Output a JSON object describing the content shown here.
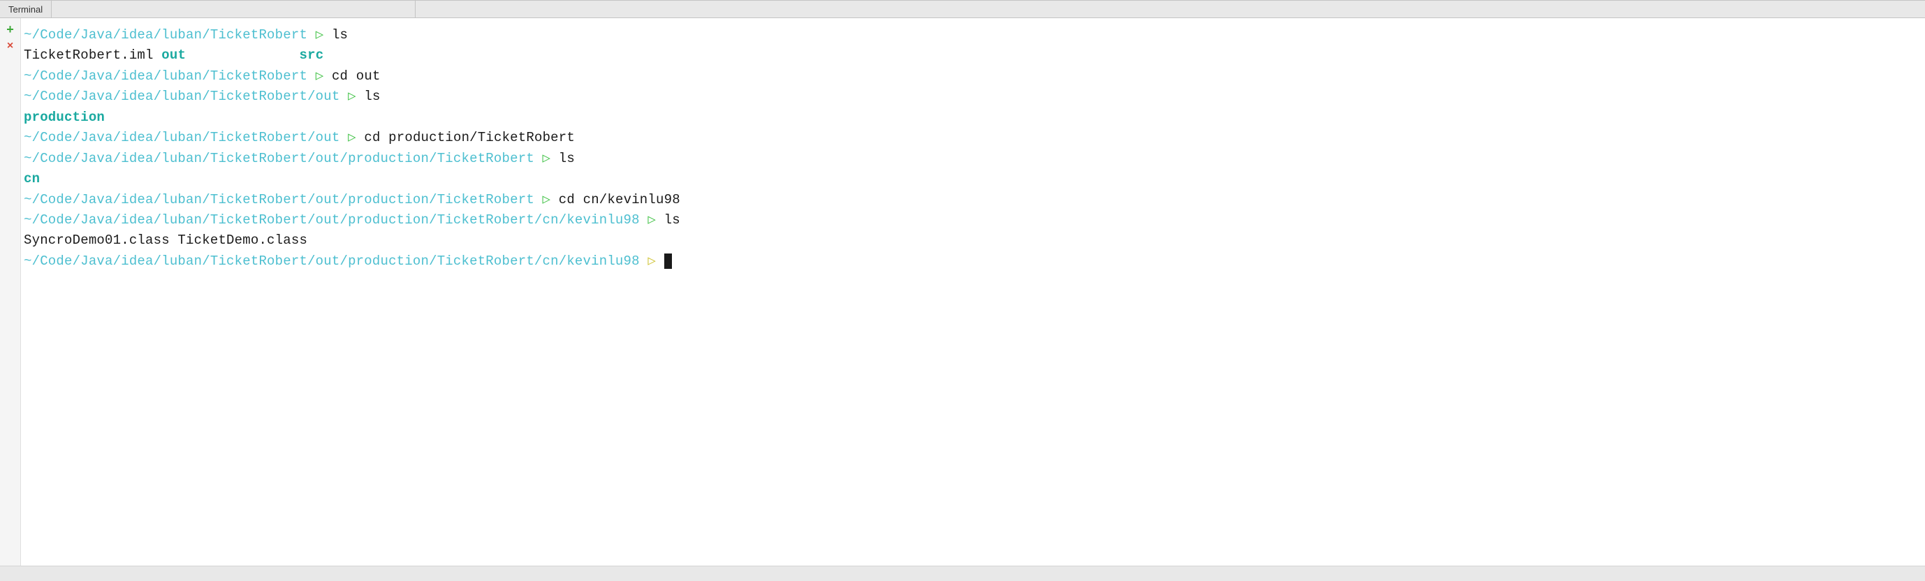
{
  "tab": {
    "label": "Terminal"
  },
  "gutter": {
    "add": "+",
    "close": "×"
  },
  "arrow": "▷",
  "lines": [
    {
      "type": "prompt",
      "path": "~/Code/Java/idea/luban/TicketRobert",
      "arrowClass": "arrow",
      "cmd": "ls"
    },
    {
      "type": "ls1",
      "file": "TicketRobert.iml ",
      "dir1": "out",
      "spacer": "              ",
      "dir2": "src"
    },
    {
      "type": "prompt",
      "path": "~/Code/Java/idea/luban/TicketRobert",
      "arrowClass": "arrow",
      "cmd": "cd out"
    },
    {
      "type": "prompt",
      "path": "~/Code/Java/idea/luban/TicketRobert/out",
      "arrowClass": "arrow",
      "cmd": "ls"
    },
    {
      "type": "dir",
      "text": "production"
    },
    {
      "type": "prompt",
      "path": "~/Code/Java/idea/luban/TicketRobert/out",
      "arrowClass": "arrow",
      "cmd": "cd production/TicketRobert"
    },
    {
      "type": "prompt",
      "path": "~/Code/Java/idea/luban/TicketRobert/out/production/TicketRobert",
      "arrowClass": "arrow",
      "cmd": "ls"
    },
    {
      "type": "dir",
      "text": "cn"
    },
    {
      "type": "prompt",
      "path": "~/Code/Java/idea/luban/TicketRobert/out/production/TicketRobert",
      "arrowClass": "arrow",
      "cmd": "cd cn/kevinlu98"
    },
    {
      "type": "prompt",
      "path": "~/Code/Java/idea/luban/TicketRobert/out/production/TicketRobert/cn/kevinlu98",
      "arrowClass": "arrow",
      "cmd": "ls"
    },
    {
      "type": "plain",
      "text": "SyncroDemo01.class TicketDemo.class"
    },
    {
      "type": "cursor",
      "path": "~/Code/Java/idea/luban/TicketRobert/out/production/TicketRobert/cn/kevinlu98",
      "arrowClass": "yellow-arrow"
    }
  ]
}
